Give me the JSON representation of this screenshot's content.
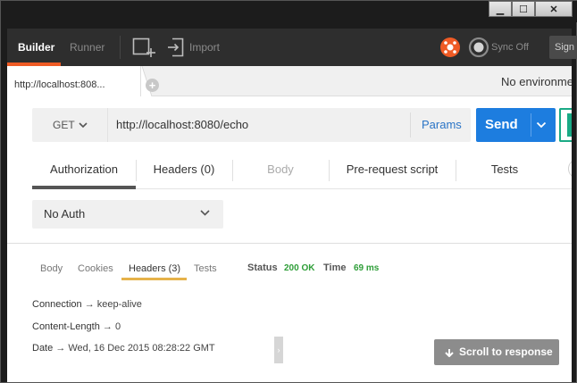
{
  "window": {
    "controls": {
      "minimize": "▁",
      "maximize": "☐",
      "close": "✕"
    }
  },
  "header": {
    "tabs": [
      {
        "label": "Builder",
        "active": true
      },
      {
        "label": "Runner",
        "active": false
      }
    ],
    "import_label": "Import",
    "sync_label": "Sync Off",
    "signin_label": "Sign"
  },
  "request_tabs": [
    {
      "label": "http://localhost:808..."
    }
  ],
  "environment": {
    "selected": "No environme"
  },
  "request": {
    "method": "GET",
    "url": "http://localhost:8080/echo",
    "params_label": "Params",
    "send_label": "Send"
  },
  "subtabs": [
    {
      "label": "Authorization",
      "active": true,
      "disabled": false
    },
    {
      "label": "Headers (0)",
      "active": false,
      "disabled": false
    },
    {
      "label": "Body",
      "active": false,
      "disabled": true
    },
    {
      "label": "Pre-request script",
      "active": false,
      "disabled": false
    },
    {
      "label": "Tests",
      "active": false,
      "disabled": false
    }
  ],
  "auth": {
    "selected": "No Auth"
  },
  "response": {
    "tabs": [
      {
        "label": "Body",
        "active": false
      },
      {
        "label": "Cookies",
        "active": false
      },
      {
        "label": "Headers (3)",
        "active": true
      },
      {
        "label": "Tests",
        "active": false
      }
    ],
    "status_label": "Status",
    "status_value": "200 OK",
    "time_label": "Time",
    "time_value": "69 ms",
    "headers": [
      {
        "key": "Connection",
        "value": "keep-alive"
      },
      {
        "key": "Content-Length",
        "value": "0"
      },
      {
        "key": "Date",
        "value": "Wed, 16 Dec 2015 08:28:22 GMT"
      }
    ],
    "arrow": "→",
    "collapse_glyph": "›",
    "scroll_label": "Scroll to response"
  },
  "colors": {
    "accent": "#ef5b25",
    "send": "#1d7ddf",
    "status_ok": "#2e9e38",
    "response_tab_underline": "#e6b24a",
    "link": "#2a74c6"
  },
  "icons": [
    "new-window-icon",
    "import-icon",
    "interceptor-icon",
    "sync-icon",
    "chevron-down-icon",
    "caret-down-icon",
    "plus-icon",
    "arrow-down-icon"
  ]
}
